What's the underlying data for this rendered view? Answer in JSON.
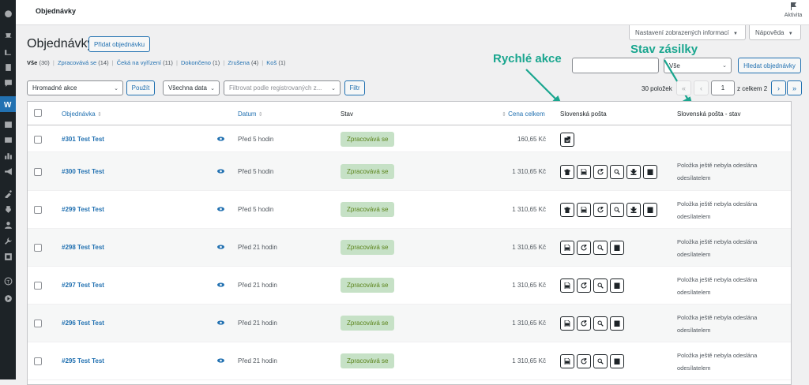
{
  "header": {
    "title": "Objednávky",
    "activity_label": "Aktivita"
  },
  "screen_options": {
    "screen_label": "Nastavení zobrazených informací",
    "help_label": "Nápověda"
  },
  "page": {
    "title": "Objednávky",
    "add_button": "Přidat objednávku"
  },
  "status_filters": [
    {
      "label": "Vše",
      "count": "(30)"
    },
    {
      "label": "Zpracovává se",
      "count": "(14)"
    },
    {
      "label": "Čeká na vyřízení",
      "count": "(11)"
    },
    {
      "label": "Dokončeno",
      "count": "(1)"
    },
    {
      "label": "Zrušena",
      "count": "(4)"
    },
    {
      "label": "Koš",
      "count": "(1)"
    }
  ],
  "search": {
    "status_select_value": "Vše",
    "search_button": "Hledat objednávky"
  },
  "annotations": {
    "quick_actions": "Rychlé akce",
    "shipment_status": "Stav zásilky"
  },
  "toolbar": {
    "bulk_actions": "Hromadné akce",
    "apply_button": "Použít",
    "dates_select": "Všechna data",
    "customer_filter_placeholder": "Filtrovat podle registrovaných z...",
    "filter_button": "Filtr"
  },
  "pagination": {
    "items_count": "30 položek",
    "first": "«",
    "prev": "‹",
    "current_page": "1",
    "of_total": "z celkem 2",
    "next": "›",
    "last": "»"
  },
  "table": {
    "columns": {
      "order": "Objednávka",
      "date": "Datum",
      "status": "Stav",
      "total": "Cena celkem",
      "quick_actions": "Slovenská pošta",
      "ship_status": "Slovenská pošta - stav"
    },
    "rows": [
      {
        "order": "#301 Test Test",
        "date": "Před 5 hodin",
        "status": "Zpracovává se",
        "total": "160,65 Kč",
        "ship_status_line1": "",
        "ship_status_line2": ""
      },
      {
        "order": "#300 Test Test",
        "date": "Před 5 hodin",
        "status": "Zpracovává se",
        "total": "1 310,65 Kč",
        "ship_status_line1": "Položka ještě nebyla odeslána",
        "ship_status_line2": "odesílatelem"
      },
      {
        "order": "#299 Test Test",
        "date": "Před 5 hodin",
        "status": "Zpracovává se",
        "total": "1 310,65 Kč",
        "ship_status_line1": "Položka ještě nebyla odeslána",
        "ship_status_line2": "odesílatelem"
      },
      {
        "order": "#298 Test Test",
        "date": "Před 21 hodin",
        "status": "Zpracovává se",
        "total": "1 310,65 Kč",
        "ship_status_line1": "Položka ještě nebyla odeslána",
        "ship_status_line2": "odesílatelem"
      },
      {
        "order": "#297 Test Test",
        "date": "Před 21 hodin",
        "status": "Zpracovává se",
        "total": "1 310,65 Kč",
        "ship_status_line1": "Položka ještě nebyla odeslána",
        "ship_status_line2": "odesílatelem"
      },
      {
        "order": "#296 Test Test",
        "date": "Před 21 hodin",
        "status": "Zpracovává se",
        "total": "1 310,65 Kč",
        "ship_status_line1": "Položka ještě nebyla odeslána",
        "ship_status_line2": "odesílatelem"
      },
      {
        "order": "#295 Test Test",
        "date": "Před 21 hodin",
        "status": "Zpracovává se",
        "total": "1 310,65 Kč",
        "ship_status_line1": "Položka ještě nebyla odeslána",
        "ship_status_line2": "odesílatelem"
      }
    ]
  },
  "colors": {
    "accent": "#2271b1",
    "status_bg": "#c6e1c6",
    "status_text": "#5b841b",
    "annotation": "#1aa68f",
    "sidebar": "#1d2327"
  }
}
